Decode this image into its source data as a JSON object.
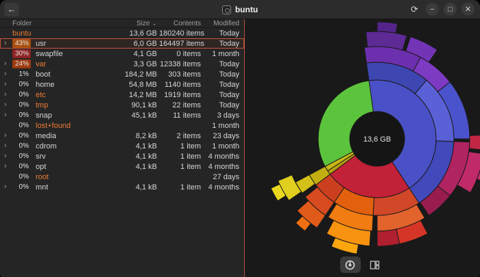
{
  "header": {
    "title": "buntu",
    "icons": {
      "back": "←",
      "refresh": "⟳",
      "minimize": "−",
      "maximize": "□",
      "close": "✕"
    }
  },
  "table": {
    "columns": {
      "folder": "Folder",
      "size": "Size",
      "contents": "Contents",
      "modified": "Modified"
    },
    "sort_indicator": "⌄",
    "chevron_glyph": "›",
    "rows": [
      {
        "chevron": false,
        "pct": "",
        "pct_bg": "",
        "name": "buntu",
        "orange": true,
        "size": "13,6 GB",
        "contents": "180240 items",
        "modified": "Today",
        "selected": false
      },
      {
        "chevron": true,
        "pct": "43%",
        "pct_bg": "#a8500f",
        "name": "usr",
        "orange": false,
        "size": "6,0 GB",
        "contents": "164497 items",
        "modified": "Today",
        "selected": true
      },
      {
        "chevron": false,
        "pct": "30%",
        "pct_bg": "#8e2424",
        "name": "swapfile",
        "orange": false,
        "size": "4,1 GB",
        "contents": "0 items",
        "modified": "1 month",
        "selected": false
      },
      {
        "chevron": true,
        "pct": "24%",
        "pct_bg": "#9d3a10",
        "name": "var",
        "orange": true,
        "size": "3,3 GB",
        "contents": "12338 items",
        "modified": "Today",
        "selected": false
      },
      {
        "chevron": true,
        "pct": "1%",
        "pct_bg": "",
        "name": "boot",
        "orange": false,
        "size": "184,2 MB",
        "contents": "303 items",
        "modified": "Today",
        "selected": false
      },
      {
        "chevron": true,
        "pct": "0%",
        "pct_bg": "",
        "name": "home",
        "orange": false,
        "size": "54,8 MB",
        "contents": "1140 items",
        "modified": "Today",
        "selected": false
      },
      {
        "chevron": true,
        "pct": "0%",
        "pct_bg": "",
        "name": "etc",
        "orange": true,
        "size": "14,2 MB",
        "contents": "1919 items",
        "modified": "Today",
        "selected": false
      },
      {
        "chevron": true,
        "pct": "0%",
        "pct_bg": "",
        "name": "tmp",
        "orange": true,
        "size": "90,1 kB",
        "contents": "22 items",
        "modified": "Today",
        "selected": false
      },
      {
        "chevron": true,
        "pct": "0%",
        "pct_bg": "",
        "name": "snap",
        "orange": false,
        "size": "45,1 kB",
        "contents": "11 items",
        "modified": "3 days",
        "selected": false
      },
      {
        "chevron": false,
        "pct": "0%",
        "pct_bg": "",
        "name": "lost+found",
        "orange": true,
        "size": "",
        "contents": "",
        "modified": "1 month",
        "selected": false
      },
      {
        "chevron": true,
        "pct": "0%",
        "pct_bg": "",
        "name": "media",
        "orange": false,
        "size": "8,2 kB",
        "contents": "2 items",
        "modified": "23 days",
        "selected": false
      },
      {
        "chevron": true,
        "pct": "0%",
        "pct_bg": "",
        "name": "cdrom",
        "orange": false,
        "size": "4,1 kB",
        "contents": "1 item",
        "modified": "1 month",
        "selected": false
      },
      {
        "chevron": true,
        "pct": "0%",
        "pct_bg": "",
        "name": "srv",
        "orange": false,
        "size": "4,1 kB",
        "contents": "1 item",
        "modified": "4 months",
        "selected": false
      },
      {
        "chevron": true,
        "pct": "0%",
        "pct_bg": "",
        "name": "opt",
        "orange": false,
        "size": "4,1 kB",
        "contents": "1 item",
        "modified": "4 months",
        "selected": false
      },
      {
        "chevron": false,
        "pct": "0%",
        "pct_bg": "",
        "name": "root",
        "orange": true,
        "size": "",
        "contents": "",
        "modified": "27 days",
        "selected": false
      },
      {
        "chevron": true,
        "pct": "0%",
        "pct_bg": "",
        "name": "mnt",
        "orange": false,
        "size": "4,1 kB",
        "contents": "1 item",
        "modified": "4 months",
        "selected": false
      }
    ]
  },
  "chart": {
    "center_label": "13,6 GB",
    "segments": [
      [
        -8,
        147,
        40,
        86,
        "#4a51c7"
      ],
      [
        147,
        233,
        40,
        86,
        "#c22138"
      ],
      [
        233,
        237,
        40,
        86,
        "#b8a50e"
      ],
      [
        237,
        242,
        40,
        86,
        "#c9b715"
      ],
      [
        242,
        352,
        40,
        86,
        "#5cc43c"
      ],
      [
        -8,
        40,
        86,
        112,
        "#3e46b2"
      ],
      [
        40,
        92,
        86,
        112,
        "#5a61d6"
      ],
      [
        92,
        147,
        86,
        112,
        "#4249ba"
      ],
      [
        147,
        183,
        86,
        112,
        "#d04828"
      ],
      [
        183,
        214,
        86,
        112,
        "#e2600e"
      ],
      [
        214,
        233,
        86,
        112,
        "#cc3f1e"
      ],
      [
        233,
        242,
        86,
        112,
        "#c2ae10"
      ],
      [
        -8,
        28,
        112,
        135,
        "#6c2fae"
      ],
      [
        28,
        52,
        112,
        135,
        "#7d3ac2"
      ],
      [
        52,
        90,
        112,
        135,
        "#4a53cc"
      ],
      [
        92,
        128,
        112,
        135,
        "#b02462"
      ],
      [
        128,
        146,
        112,
        135,
        "#981d4e"
      ],
      [
        149,
        180,
        112,
        135,
        "#e2632c"
      ],
      [
        183,
        212,
        112,
        135,
        "#f07c12"
      ],
      [
        214,
        231,
        112,
        135,
        "#d84a20"
      ],
      [
        234,
        242,
        112,
        135,
        "#d3c018"
      ],
      [
        -6,
        16,
        135,
        157,
        "#5d2a96"
      ],
      [
        18,
        34,
        135,
        157,
        "#7334b6"
      ],
      [
        88,
        96,
        135,
        157,
        "#c22643"
      ],
      [
        98,
        120,
        135,
        157,
        "#c02a68"
      ],
      [
        152,
        168,
        135,
        157,
        "#d43527"
      ],
      [
        168,
        180,
        135,
        157,
        "#b02030"
      ],
      [
        184,
        208,
        135,
        157,
        "#f89310"
      ],
      [
        214,
        228,
        135,
        157,
        "#e05a1a"
      ],
      [
        235,
        247,
        135,
        157,
        "#e0cf1e"
      ],
      [
        0,
        10,
        157,
        171,
        "#54248a"
      ],
      [
        104,
        112,
        157,
        171,
        "#cb2d6e"
      ],
      [
        190,
        203,
        157,
        171,
        "#fda50f"
      ],
      [
        218,
        224,
        157,
        171,
        "#ef6f12"
      ],
      [
        238,
        245,
        157,
        171,
        "#ead81f"
      ]
    ]
  },
  "toolbar": {
    "rings_icon": "rings-chart",
    "treemap_icon": "treemap-chart"
  }
}
